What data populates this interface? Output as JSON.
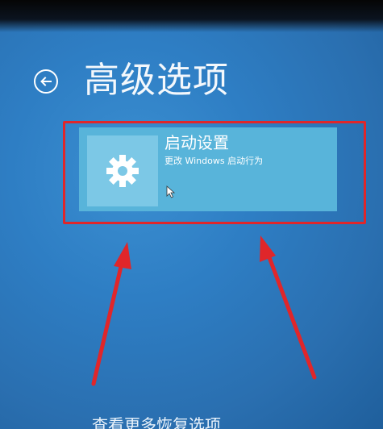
{
  "header": {
    "title": "高级选项",
    "back_icon": "back-arrow-icon"
  },
  "tile": {
    "title": "启动设置",
    "description": "更改 Windows 启动行为",
    "icon": "gear-icon"
  },
  "footer": {
    "more_options": "查看更多恢复选项"
  },
  "colors": {
    "background": "#2e7ec4",
    "tile": "#58b4da",
    "tile_icon_box": "#7cc8e6",
    "annotation": "#e0262a"
  }
}
